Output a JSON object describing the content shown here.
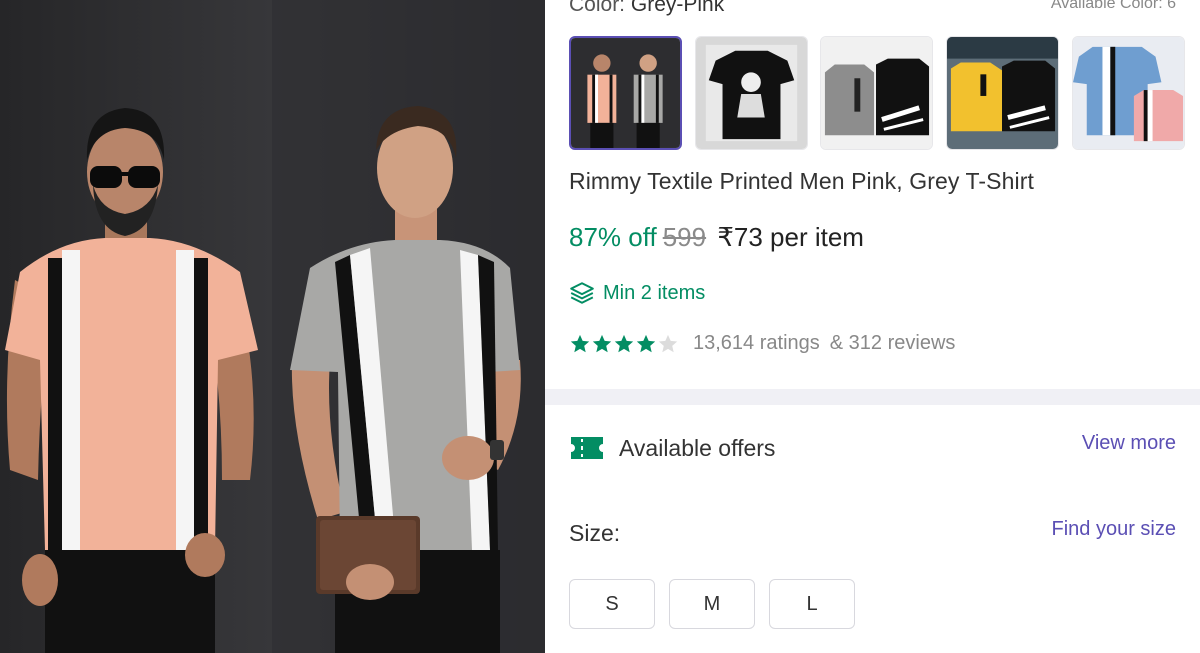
{
  "color_selector": {
    "label": "Color:",
    "selected": "Grey-Pink",
    "available": "Available Color: 6"
  },
  "thumbnails": [
    {
      "name": "grey-pink",
      "selected": true
    },
    {
      "name": "black-print",
      "selected": false
    },
    {
      "name": "grey-black-zoom",
      "selected": false
    },
    {
      "name": "yellow-black-zoom",
      "selected": false
    },
    {
      "name": "blue-pink",
      "selected": false
    }
  ],
  "product": {
    "title": "Rimmy Textile Printed Men Pink, Grey T-Shirt",
    "discount": "87% off",
    "mrp": "599",
    "price": "₹73",
    "per_item": "per item",
    "min_items": "Min 2 items",
    "rating_value": 4,
    "ratings": "13,614 ratings",
    "reviews": "& 312 reviews"
  },
  "offers": {
    "label": "Available offers",
    "view_more": "View more"
  },
  "size": {
    "label": "Size:",
    "find_size": "Find your size",
    "options": [
      "S",
      "M",
      "L"
    ]
  },
  "colors": {
    "accent": "#5b4fb4",
    "green": "#038d63",
    "star_filled": "#038d63",
    "star_empty": "#dcdcdc"
  }
}
